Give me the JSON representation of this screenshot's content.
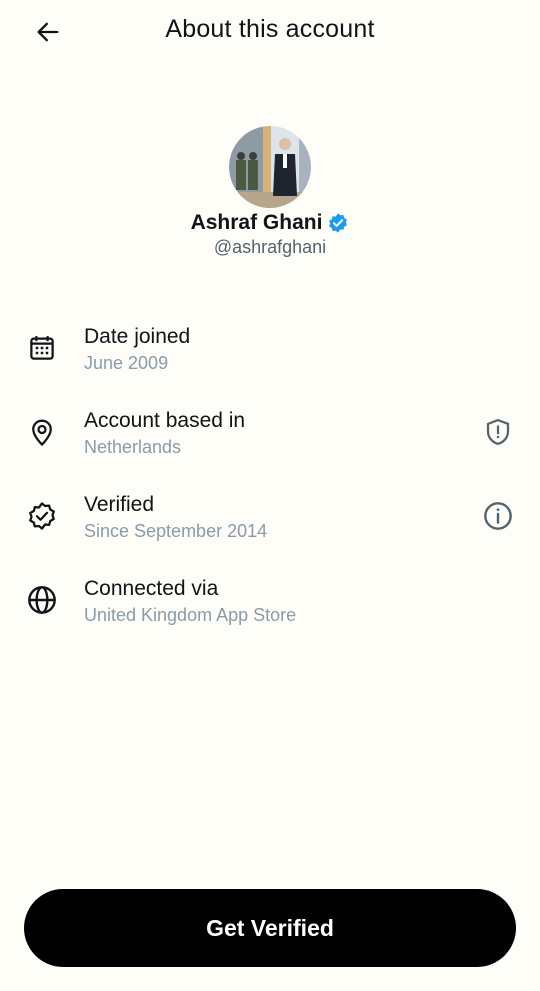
{
  "header": {
    "title": "About this account",
    "back_icon": "arrow-left-icon"
  },
  "profile": {
    "name": "Ashraf Ghani",
    "handle": "@ashrafghani",
    "verified_badge_color": "#1D9BF0"
  },
  "info_rows": [
    {
      "icon": "calendar-icon",
      "title": "Date joined",
      "subtitle": "June 2009"
    },
    {
      "icon": "location-pin-icon",
      "title": "Account based in",
      "subtitle": "Netherlands",
      "action_icon": "shield-icon"
    },
    {
      "icon": "verified-check-icon",
      "title": "Verified",
      "subtitle": "Since September 2014",
      "action_icon": "info-icon"
    },
    {
      "icon": "globe-icon",
      "title": "Connected via",
      "subtitle": "United Kingdom App Store"
    }
  ],
  "cta": {
    "label": "Get Verified"
  },
  "colors": {
    "background": "#FEFDF7",
    "text_primary": "#0F1419",
    "text_secondary": "#8A9BAC",
    "button_bg": "#000000",
    "button_text": "#FFFFFF"
  }
}
